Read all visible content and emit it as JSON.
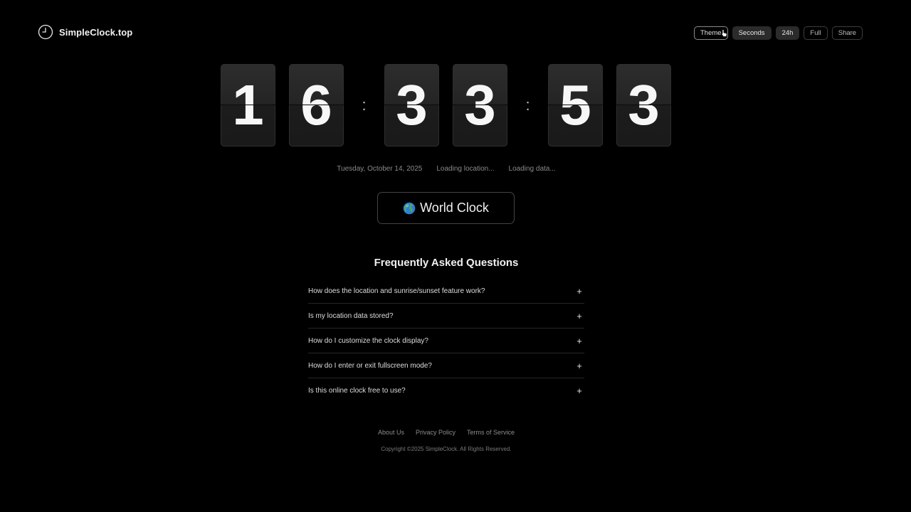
{
  "header": {
    "brand": "SimpleClock.top",
    "logo_icon": "clock-icon",
    "buttons": [
      {
        "label": "Theme",
        "active": false
      },
      {
        "label": "Seconds",
        "active": true
      },
      {
        "label": "24h",
        "active": true
      },
      {
        "label": "Full",
        "active": false
      },
      {
        "label": "Share",
        "active": false
      }
    ]
  },
  "clock": {
    "digits": [
      "1",
      "6",
      "3",
      "3",
      "5",
      "3"
    ],
    "separator": ":"
  },
  "info": {
    "date": "Tuesday, October 14, 2025",
    "location": "Loading location...",
    "data": "Loading data..."
  },
  "world_clock": {
    "label": "World Clock",
    "icon": "globe-icon"
  },
  "faq": {
    "title": "Frequently Asked Questions",
    "items": [
      "How does the location and sunrise/sunset feature work?",
      "Is my location data stored?",
      "How do I customize the clock display?",
      "How do I enter or exit fullscreen mode?",
      "Is this online clock free to use?"
    ],
    "expand_symbol": "+"
  },
  "footer": {
    "links": [
      "About Us",
      "Privacy Policy",
      "Terms of Service"
    ],
    "copyright": "Copyright ©2025 SimpleClock. All Rights Reserved."
  },
  "colors": {
    "background": "#000000",
    "tile": "#242424",
    "text": "#ffffff",
    "muted": "#8a8a8a"
  }
}
